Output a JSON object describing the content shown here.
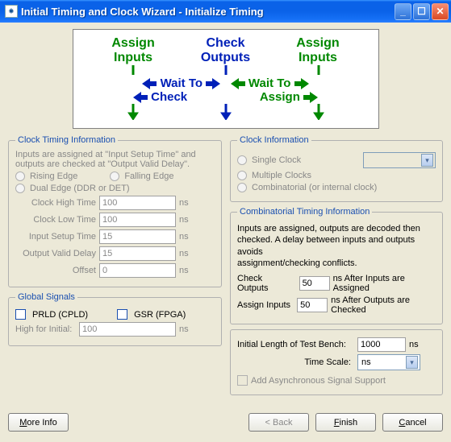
{
  "window": {
    "title": "Initial Timing and Clock Wizard - Initialize Timing"
  },
  "diagram": {
    "assign": "Assign",
    "inputs": "Inputs",
    "check": "Check",
    "outputs": "Outputs",
    "wait_check": "Wait To",
    "wait_check2": "Check",
    "wait_assign": "Wait To",
    "wait_assign2": "Assign"
  },
  "cti": {
    "legend": "Clock Timing Information",
    "desc1": "Inputs are assigned at \"Input Setup Time\" and",
    "desc2": "outputs are checked at \"Output Valid Delay\".",
    "rising": "Rising Edge",
    "falling": "Falling Edge",
    "dual": "Dual Edge (DDR or DET)",
    "clock_high": "Clock High Time",
    "clock_low": "Clock Low Time",
    "input_setup": "Input Setup Time",
    "output_valid": "Output Valid Delay",
    "offset": "Offset",
    "v_clock_high": "100",
    "v_clock_low": "100",
    "v_input_setup": "15",
    "v_output_valid": "15",
    "v_offset": "0",
    "ns": "ns"
  },
  "gs": {
    "legend": "Global Signals",
    "prld": "PRLD (CPLD)",
    "gsr": "GSR (FPGA)",
    "high_label": "High for Initial:",
    "high_value": "100",
    "ns": "ns"
  },
  "ci": {
    "legend": "Clock Information",
    "single": "Single Clock",
    "multiple": "Multiple Clocks",
    "comb": "Combinatorial (or internal clock)"
  },
  "combti": {
    "legend": "Combinatorial Timing Information",
    "desc1": "Inputs are assigned, outputs are decoded then",
    "desc2": "checked.  A delay between inputs and outputs avoids",
    "desc3": "assignment/checking conflicts.",
    "check_outputs": "Check Outputs",
    "assign_inputs": "Assign Inputs",
    "after_inputs": "ns  After Inputs are Assigned",
    "after_outputs": "ns  After Outputs are Checked",
    "v_check": "50",
    "v_assign": "50"
  },
  "tb": {
    "len_label": "Initial Length of Test Bench:",
    "len_value": "1000",
    "ns": "ns",
    "scale_label": "Time Scale:",
    "scale_value": "ns",
    "async": "Add Asynchronous Signal Support"
  },
  "buttons": {
    "more_info": "More Info",
    "back": "< Back",
    "finish": "Finish",
    "cancel": "Cancel"
  }
}
